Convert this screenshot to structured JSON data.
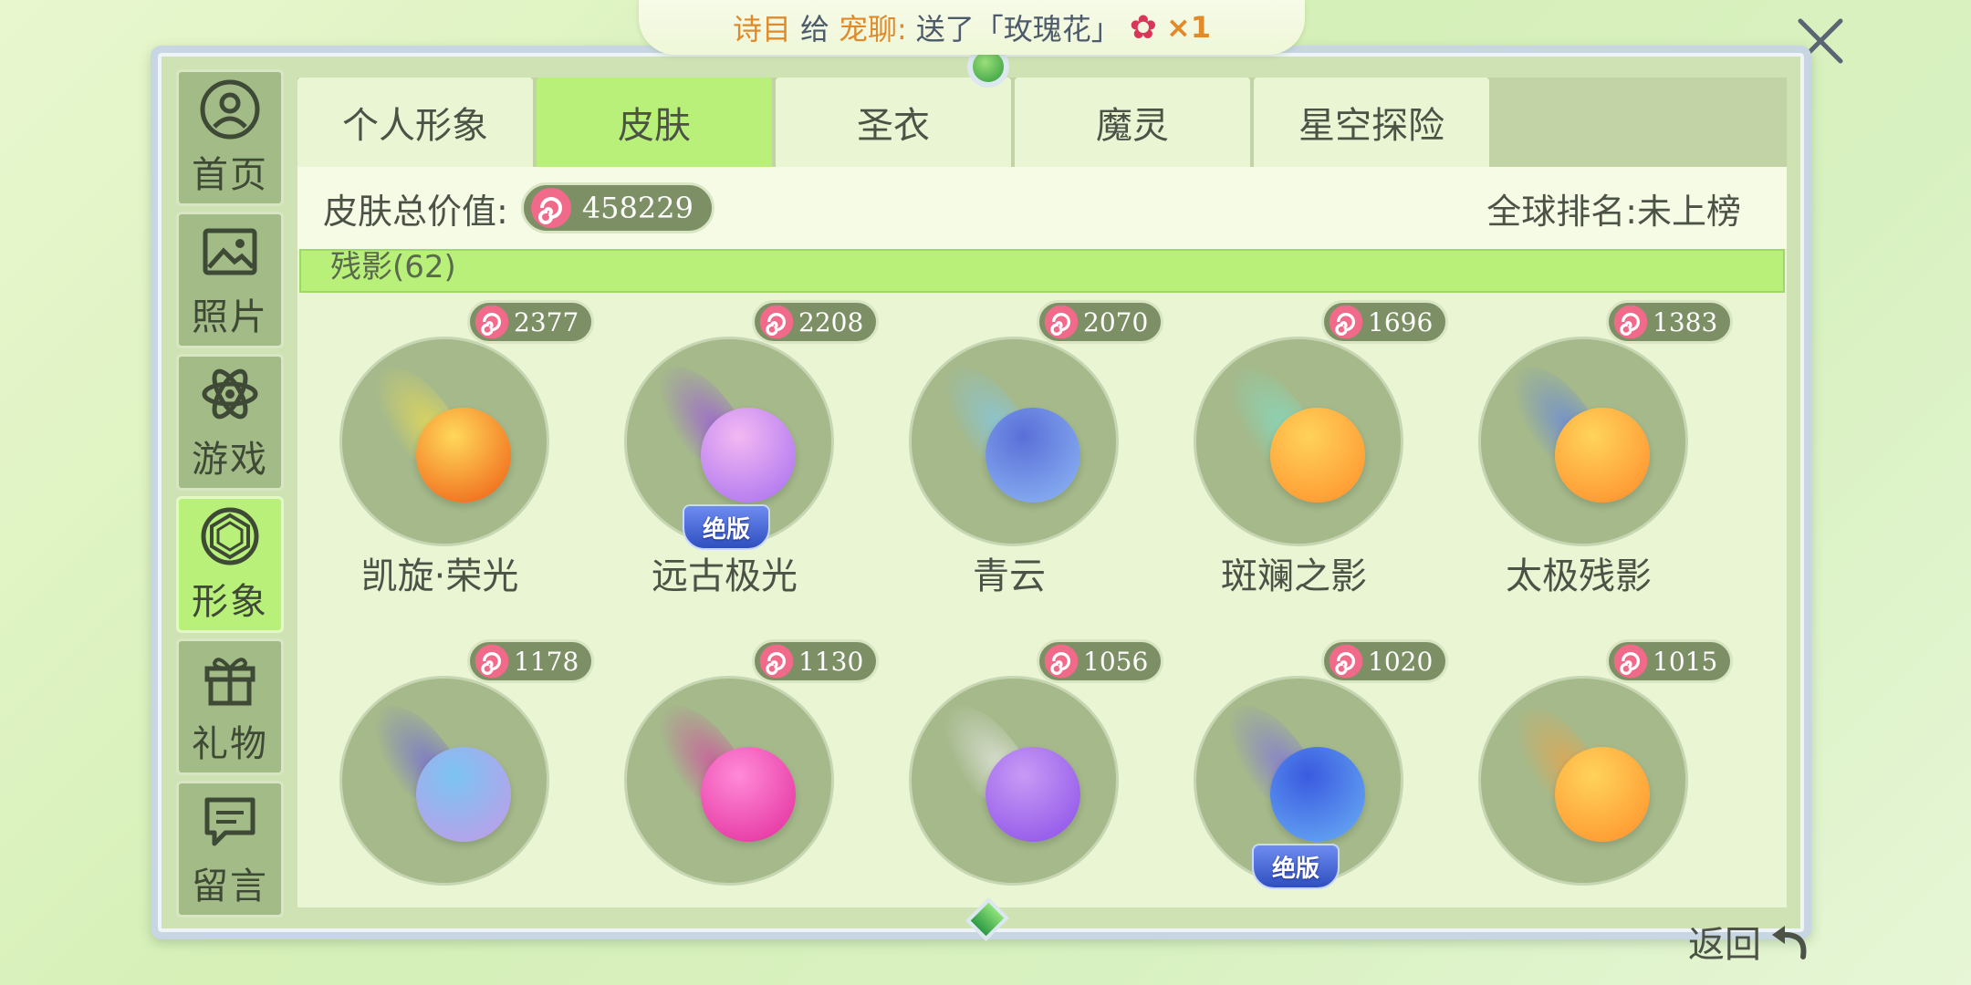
{
  "notice": {
    "sender": "诗目",
    "to_prefix": "给",
    "receiver": "宠聊:",
    "message": "送了「玫瑰花」",
    "quantity": "×1"
  },
  "sidebar": {
    "items": [
      {
        "label": "首页",
        "icon": "user-circle-icon",
        "active": false
      },
      {
        "label": "照片",
        "icon": "photo-icon",
        "active": false
      },
      {
        "label": "游戏",
        "icon": "atom-icon",
        "active": false
      },
      {
        "label": "形象",
        "icon": "gem-icon",
        "active": true
      },
      {
        "label": "礼物",
        "icon": "gift-icon",
        "active": false
      },
      {
        "label": "留言",
        "icon": "message-icon",
        "active": false
      }
    ]
  },
  "tabs": [
    {
      "label": "个人形象",
      "active": false
    },
    {
      "label": "皮肤",
      "active": true
    },
    {
      "label": "圣衣",
      "active": false
    },
    {
      "label": "魔灵",
      "active": false
    },
    {
      "label": "星空探险",
      "active": false
    }
  ],
  "summary": {
    "value_label": "皮肤总价值:",
    "value": "458229",
    "rank_label": "全球排名:未上榜"
  },
  "category": {
    "label": "残影(62)"
  },
  "skins": [
    {
      "name": "凯旋·荣光",
      "price": "2377",
      "colors": [
        "#ffd85a",
        "#ee5a12"
      ],
      "trail": "#f4e04a",
      "discontinued": false
    },
    {
      "name": "远古极光",
      "price": "2208",
      "colors": [
        "#f3b8f2",
        "#a56df0"
      ],
      "trail": "#9b48e6",
      "discontinued": true
    },
    {
      "name": "青云",
      "price": "2070",
      "colors": [
        "#5a6fd8",
        "#8fb8f5"
      ],
      "trail": "#7fc8f2",
      "discontinued": false
    },
    {
      "name": "斑斓之影",
      "price": "1696",
      "colors": [
        "#ffd25a",
        "#ff8f2a"
      ],
      "trail": "#7de0c8",
      "discontinued": false
    },
    {
      "name": "太极残影",
      "price": "1383",
      "colors": [
        "#ffd45a",
        "#ff8a2a"
      ],
      "trail": "#5b7de8",
      "discontinued": false
    },
    {
      "name": "",
      "price": "1178",
      "colors": [
        "#7bc4f2",
        "#c49ae8"
      ],
      "trail": "#6a5ee0",
      "discontinued": false
    },
    {
      "name": "",
      "price": "1130",
      "colors": [
        "#ff8ad8",
        "#e22a9a"
      ],
      "trail": "#d83aa2",
      "discontinued": false
    },
    {
      "name": "",
      "price": "1056",
      "colors": [
        "#c89af5",
        "#8a4ee8"
      ],
      "trail": "#eeeeee",
      "discontinued": false
    },
    {
      "name": "",
      "price": "1020",
      "colors": [
        "#3a5ae0",
        "#6ab0f5"
      ],
      "trail": "#7a68e8",
      "discontinued": true
    },
    {
      "name": "",
      "price": "1015",
      "colors": [
        "#ffd35a",
        "#ff8f2a"
      ],
      "trail": "#f0a040",
      "discontinued": false
    }
  ],
  "badge_label": "绝版",
  "back_label": "返回",
  "colors": {
    "accent_green": "#b8f07a",
    "panel": "#eaf5d4",
    "pill": "#7d8f64"
  }
}
